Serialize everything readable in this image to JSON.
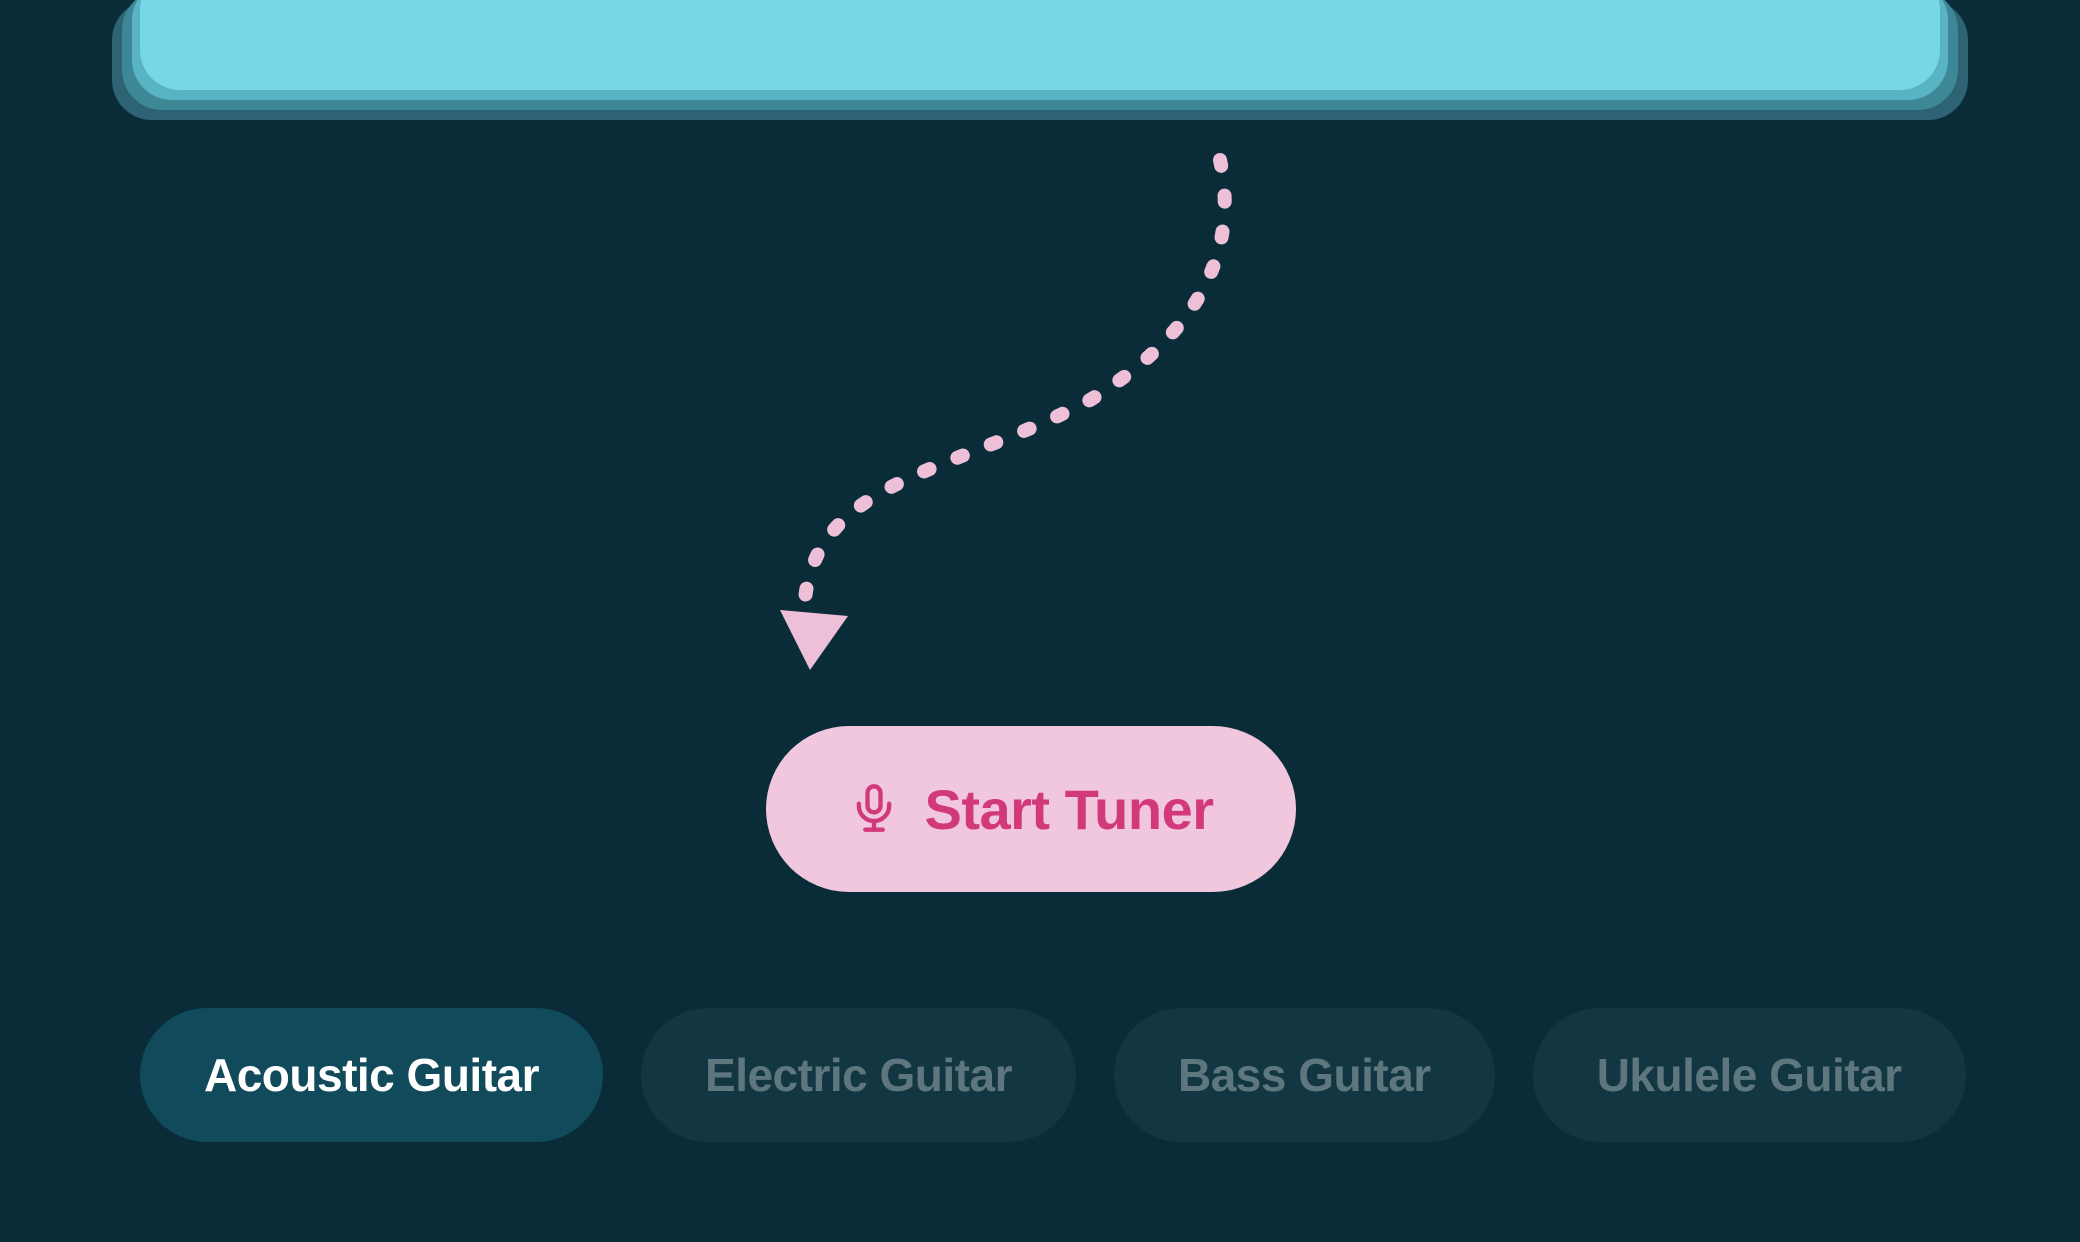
{
  "cta": {
    "label": "Start Tuner"
  },
  "tabs": {
    "active_index": 0,
    "items": [
      {
        "label": "Acoustic Guitar"
      },
      {
        "label": "Electric Guitar"
      },
      {
        "label": "Bass Guitar"
      },
      {
        "label": "Ukulele Guitar"
      }
    ]
  },
  "colors": {
    "background": "#0a2c38",
    "cta_bg": "#f0c7dc",
    "cta_fg": "#d2397b",
    "arrow": "#eec0d8",
    "tab_active_bg": "#114a5a",
    "tab_active_fg": "#ffffff",
    "tab_inactive_bg": "#123642",
    "tab_inactive_fg": "#5e767e"
  }
}
